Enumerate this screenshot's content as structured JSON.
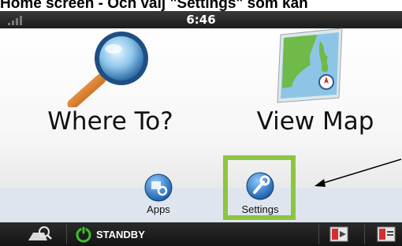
{
  "caption": {
    "text": "Home screen - Och välj \"Settings\" som kan",
    "bold_lead": "Home screen",
    "rest": " - Och välj ",
    "bold_settings": "\"Settings\"",
    "tail": " som kan"
  },
  "status_bar": {
    "time": "6:46",
    "signal_icon": "signal-bars-icon"
  },
  "main": {
    "where_to": {
      "label": "Where To?",
      "icon": "magnifier-icon"
    },
    "view_map": {
      "label": "View Map",
      "icon": "map-icon"
    }
  },
  "strip": {
    "apps": {
      "label": "Apps",
      "icon": "apps-gear-icon"
    },
    "settings": {
      "label": "Settings",
      "icon": "wrench-icon"
    }
  },
  "bottom_bar": {
    "search_icon": "vehicle-search-icon",
    "standby_label": "STANDBY",
    "standby_icon": "power-icon",
    "media_icon_1": "media-play-icon",
    "media_icon_2": "media-card-icon"
  },
  "colors": {
    "highlight": "#8cc640",
    "status_bar": "#2a2a2a",
    "strip": "#dfe5ee",
    "power_green": "#3fbf2a"
  }
}
